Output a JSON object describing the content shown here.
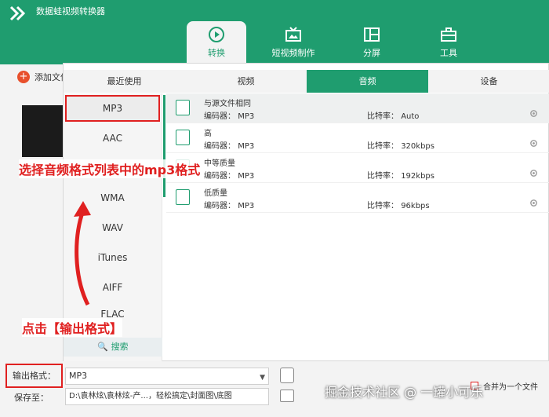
{
  "app": {
    "title": "数据蛙视频转换器"
  },
  "nav": [
    {
      "label": "转换",
      "icon": "convert-icon",
      "active": true
    },
    {
      "label": "短视频制作",
      "icon": "tv-icon",
      "active": false
    },
    {
      "label": "分屏",
      "icon": "split-screen-icon",
      "active": false
    },
    {
      "label": "工具",
      "icon": "toolbox-icon",
      "active": false
    }
  ],
  "main": {
    "add_file_label": "添加文件"
  },
  "popup": {
    "categories": [
      "最近使用",
      "视频",
      "音频",
      "设备"
    ],
    "active_category": "音频",
    "formats": [
      "MP3",
      "AAC",
      "WMA",
      "WAV",
      "iTunes",
      "AIFF",
      "FLAC"
    ],
    "selected_format": "MP3",
    "search_label": "搜索",
    "qualities": [
      {
        "name": "与源文件相同",
        "encoder_label": "编码器：",
        "encoder": "MP3",
        "bitrate_label": "比特率：",
        "bitrate": "Auto"
      },
      {
        "name": "高",
        "encoder_label": "编码器：",
        "encoder": "MP3",
        "bitrate_label": "比特率：",
        "bitrate": "320kbps"
      },
      {
        "name": "中等质量",
        "encoder_label": "编码器：",
        "encoder": "MP3",
        "bitrate_label": "比特率：",
        "bitrate": "192kbps"
      },
      {
        "name": "低质量",
        "encoder_label": "编码器：",
        "encoder": "MP3",
        "bitrate_label": "比特率：",
        "bitrate": "96kbps"
      }
    ]
  },
  "bottom": {
    "output_label": "输出格式：",
    "output_value": "MP3",
    "save_label": "保存至：",
    "save_path": "D:\\袁林炫\\袁林炫-产...，轻松搞定\\封面图\\底图",
    "merge_label": "合并为一个文件"
  },
  "annotations": {
    "select_mp3": "选择音频格式列表中的mp3格式",
    "click_output": "点击【输出格式】"
  },
  "watermark": "掘金技术社区 @ 一罐小可乐",
  "colors": {
    "brand": "#1f9d6f",
    "annotation": "#e02020",
    "accent": "#e8502c"
  }
}
